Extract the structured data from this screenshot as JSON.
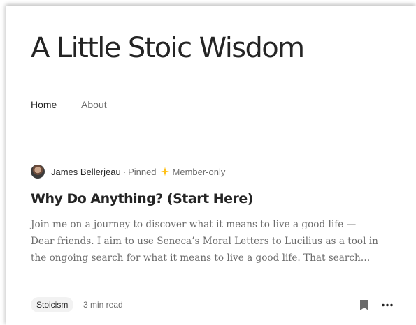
{
  "blog": {
    "title": "A Little Stoic Wisdom"
  },
  "nav": {
    "tabs": [
      {
        "label": "Home",
        "active": true
      },
      {
        "label": "About",
        "active": false
      }
    ]
  },
  "post": {
    "author": "James Bellerjeau",
    "separator": "·",
    "pinned": "Pinned",
    "member_label": "Member-only",
    "title": "Why Do Anything? (Start Here)",
    "excerpt_lines": [
      "Join me on a journey to discover what it means to live a good life —",
      "Dear friends. I aim to use Seneca’s Moral Letters to Lucilius as a tool in",
      "the ongoing search for what it means to live a good life. That search…"
    ],
    "tag": "Stoicism",
    "read_time": "3 min read"
  },
  "icons": {
    "star": "member-star-icon",
    "bookmark": "bookmark-icon",
    "more": "more-options-icon"
  },
  "colors": {
    "text_primary": "#242424",
    "text_secondary": "#6b6b6b",
    "star": "#ffc017",
    "tag_bg": "#f2f2f2",
    "divider": "#e6e6e6"
  }
}
